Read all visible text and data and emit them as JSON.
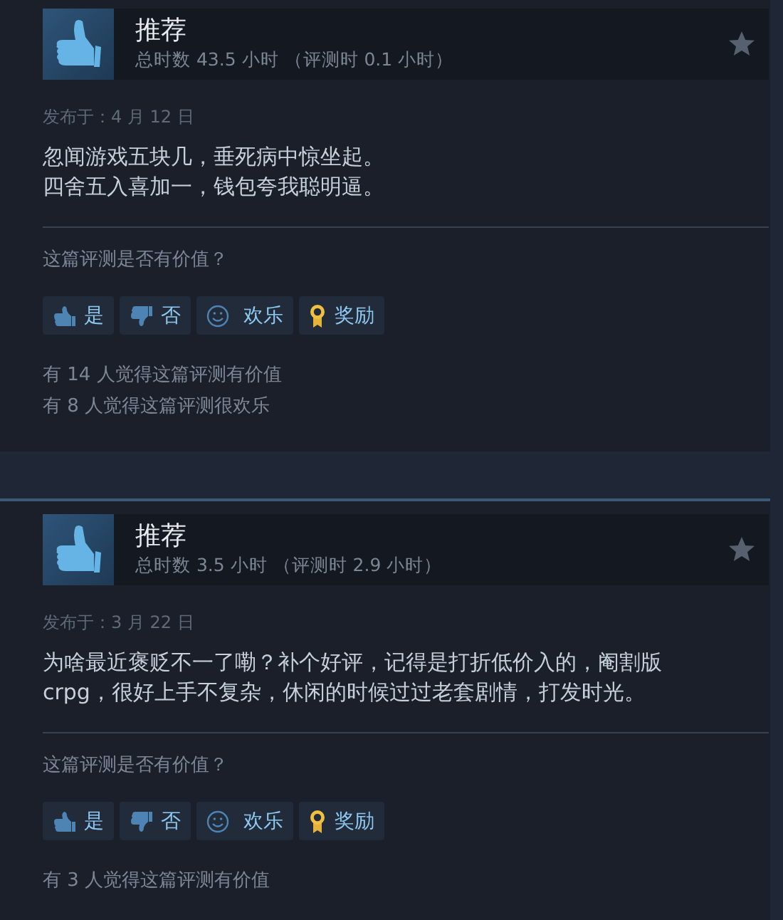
{
  "reviews": [
    {
      "verdict": "推荐",
      "hours": "总时数 43.5 小时 （评测时 0.1 小时）",
      "posted": "发布于：4 月 12 日",
      "body": [
        "忽闻游戏五块几，垂死病中惊坐起。",
        "四舍五入喜加一，钱包夸我聪明逼。"
      ],
      "question": "这篇评测是否有价值？",
      "buttons": [
        {
          "kind": "yes",
          "label": "是"
        },
        {
          "kind": "no",
          "label": "否"
        },
        {
          "kind": "funny",
          "label": "欢乐"
        },
        {
          "kind": "award",
          "label": "奖励"
        }
      ],
      "counts": [
        "有 14 人觉得这篇评测有价值",
        "有 8 人觉得这篇评测很欢乐"
      ]
    },
    {
      "verdict": "推荐",
      "hours": "总时数 3.5 小时 （评测时 2.9 小时）",
      "posted": "发布于：3 月 22 日",
      "body": [
        "为啥最近褒贬不一了嘞？补个好评，记得是打折低价入的，阉割版",
        "crpg，很好上手不复杂，休闲的时候过过老套剧情，打发时光。"
      ],
      "question": "这篇评测是否有价值？",
      "buttons": [
        {
          "kind": "yes",
          "label": "是"
        },
        {
          "kind": "no",
          "label": "否"
        },
        {
          "kind": "funny",
          "label": "欢乐"
        },
        {
          "kind": "award",
          "label": "奖励"
        }
      ],
      "counts": [
        "有 3 人觉得这篇评测有价值"
      ]
    }
  ]
}
